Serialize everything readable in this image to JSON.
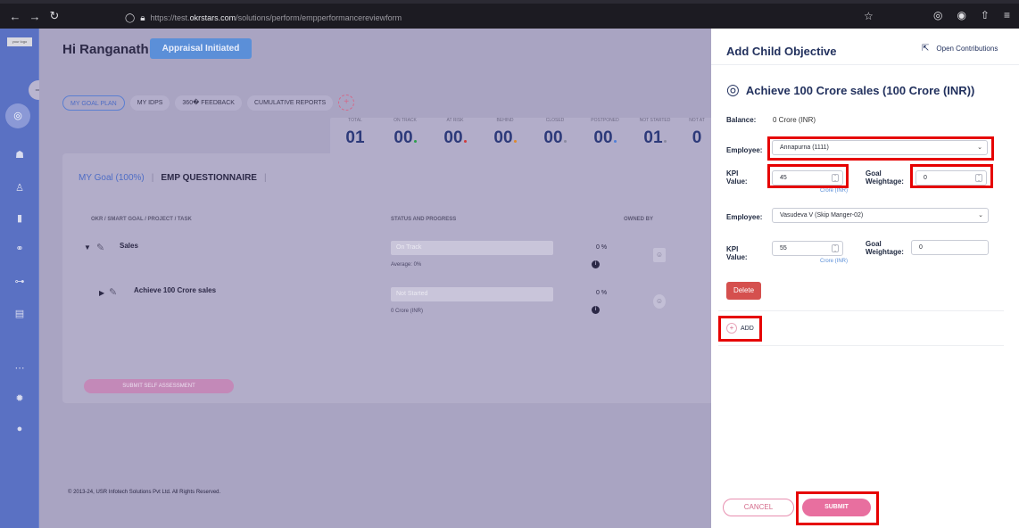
{
  "browser": {
    "url_prefix": "https://test.",
    "url_host": "okrstars.com",
    "url_path": "/solutions/perform/empperformancereviewform"
  },
  "header": {
    "greeting": "Hi Ranganath",
    "status_button": "Appraisal Initiated"
  },
  "tabs": [
    "MY GOAL PLAN",
    "MY IDPS",
    "360� FEEDBACK",
    "CUMULATIVE REPORTS"
  ],
  "stats": [
    {
      "label": "TOTAL",
      "value": "01",
      "dot": ""
    },
    {
      "label": "ON TRACK",
      "value": "00",
      "dot": "#2aa04a"
    },
    {
      "label": "AT RISK",
      "value": "00",
      "dot": "#d03a3a"
    },
    {
      "label": "BEHIND",
      "value": "00",
      "dot": "#e0892a"
    },
    {
      "label": "CLOSED",
      "value": "00",
      "dot": "#8a8aa0"
    },
    {
      "label": "POSTPONED",
      "value": "00",
      "dot": "#4f7fd8"
    },
    {
      "label": "NOT STARTED",
      "value": "01",
      "dot": "#8a8aa0"
    },
    {
      "label": "NOT AT",
      "value": "0",
      "dot": ""
    }
  ],
  "card": {
    "tab_my_goal": "MY Goal (100%)",
    "tab_emp": "EMP QUESTIONNAIRE",
    "col_okr": "OKR / SMART GOAL / PROJECT / TASK",
    "col_status": "STATUS AND PROGRESS",
    "col_owned": "OWNED BY",
    "rows": [
      {
        "title": "Sales",
        "status": "On Track",
        "sub": "Average: 0%",
        "pct": "0 %"
      },
      {
        "title": "Achieve 100 Crore sales",
        "status": "Not Started",
        "sub": "0 Crore (INR)",
        "pct": "0 %"
      }
    ],
    "self_assessment": "SUBMIT SELF ASSESSMENT"
  },
  "footer": "© 2013-24, USR Infotech Solutions Pvt Ltd. All Rights Reserved.",
  "panel": {
    "title": "Add Child Objective",
    "open_contrib": "Open Contributions",
    "objective": "Achieve 100 Crore sales (100 Crore (INR))",
    "balance_label": "Balance:",
    "balance_value": "0 Crore (INR)",
    "employee_label": "Employee:",
    "kpi_label_1": "KPI",
    "kpi_label_2": "Value:",
    "goal_label_1": "Goal",
    "goal_label_2": "Weightage:",
    "unit": "Crore (INR)",
    "entries": [
      {
        "employee": "Annapurna (1111)",
        "kpi": "45",
        "weightage": "0"
      },
      {
        "employee": "Vasudeva V (Skip Manger-02)",
        "kpi": "55",
        "weightage": "0"
      }
    ],
    "delete": "Delete",
    "add": "ADD",
    "cancel": "CANCEL",
    "submit": "SUBMIT"
  }
}
